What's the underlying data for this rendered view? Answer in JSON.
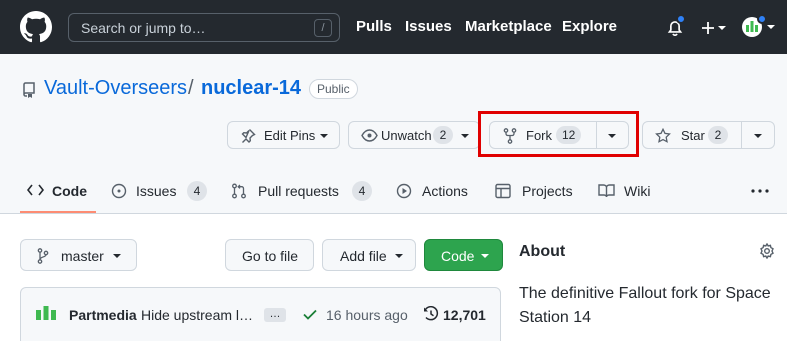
{
  "header": {
    "search_placeholder": "Search or jump to…",
    "search_shortcut": "/",
    "nav": [
      "Pulls",
      "Issues",
      "Marketplace",
      "Explore"
    ],
    "notification_dot_color": "#2f81f7"
  },
  "repo": {
    "owner": "Vault-Overseers",
    "separator": "/",
    "name": "nuclear-14",
    "visibility": "Public"
  },
  "actions": {
    "edit_pins": "Edit Pins",
    "unwatch": "Unwatch",
    "unwatch_count": "2",
    "fork": "Fork",
    "fork_count": "12",
    "star": "Star",
    "star_count": "2",
    "highlight_color": "#e00000"
  },
  "tabs": [
    {
      "label": "Code",
      "count": null,
      "icon": "code-icon",
      "selected": true
    },
    {
      "label": "Issues",
      "count": "4",
      "icon": "issue-opened-icon",
      "selected": false
    },
    {
      "label": "Pull requests",
      "count": "4",
      "icon": "git-pull-request-icon",
      "selected": false
    },
    {
      "label": "Actions",
      "count": null,
      "icon": "play-icon",
      "selected": false
    },
    {
      "label": "Projects",
      "count": null,
      "icon": "table-icon",
      "selected": false
    },
    {
      "label": "Wiki",
      "count": null,
      "icon": "book-icon",
      "selected": false
    }
  ],
  "files": {
    "branch": "master",
    "go_to_file": "Go to file",
    "add_file": "Add file",
    "code": "Code"
  },
  "commit": {
    "author": "Partmedia",
    "message": "Hide upstream l…",
    "ellipsis": "…",
    "time": "16 hours ago",
    "count": "12,701"
  },
  "about": {
    "title": "About",
    "description": "The definitive Fallout fork for Space Station 14"
  },
  "colors": {
    "header_bg": "#24292f",
    "link": "#0969da",
    "primary_button": "#2da44e",
    "tab_underline": "#fd8c73"
  }
}
